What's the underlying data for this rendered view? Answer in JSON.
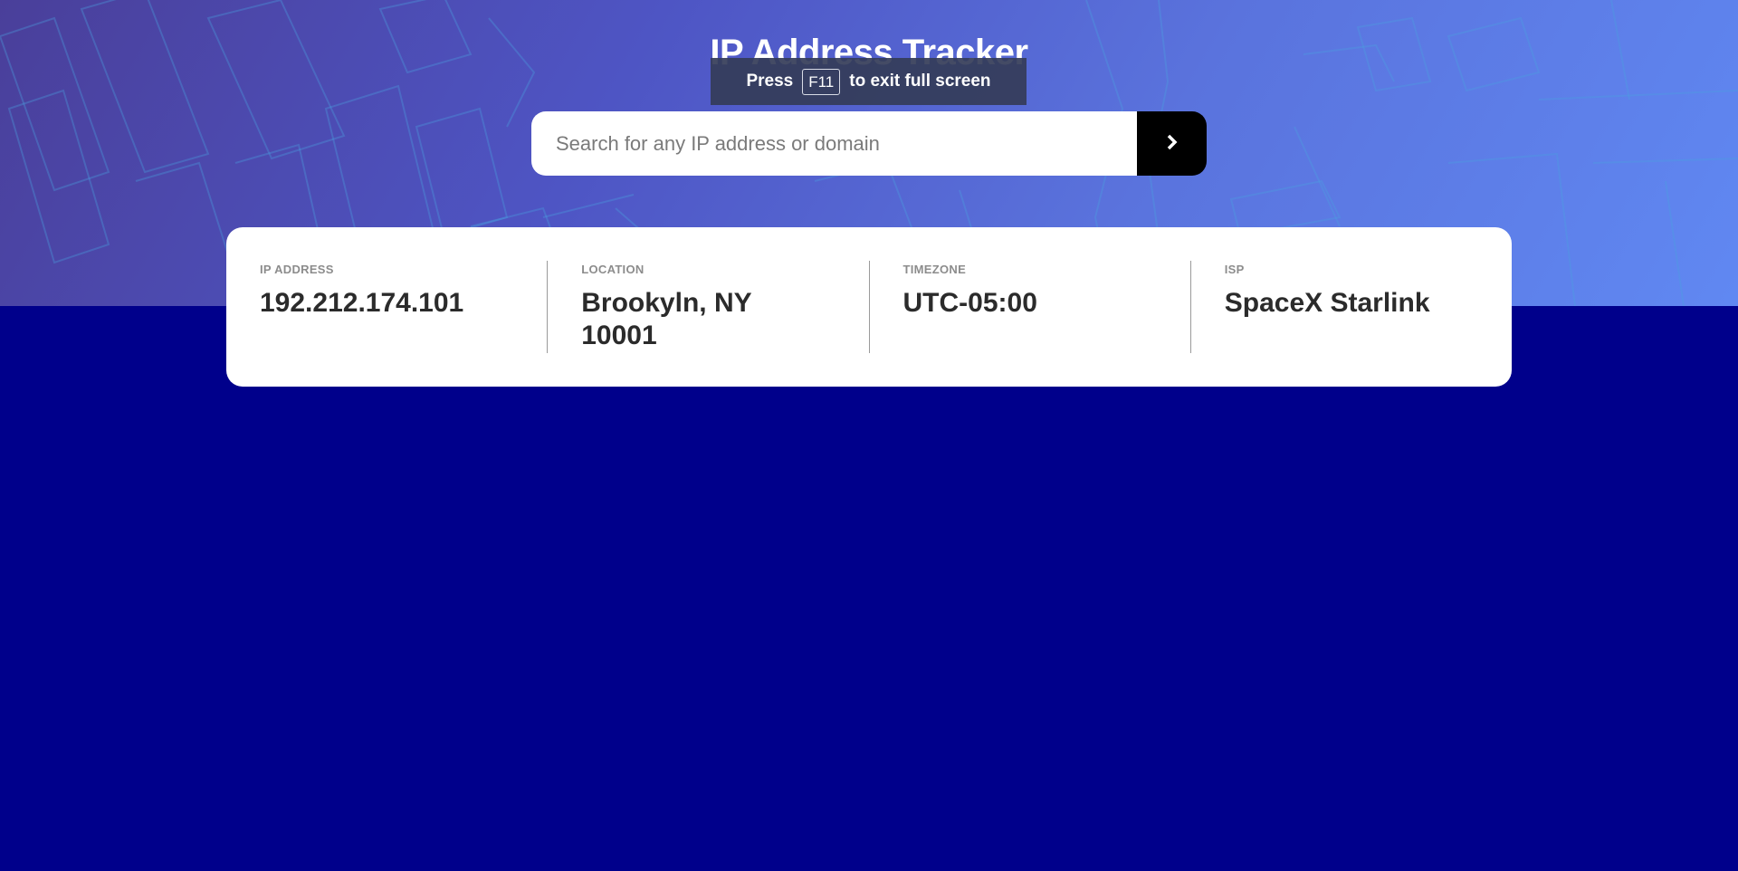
{
  "header": {
    "title": "IP Address Tracker"
  },
  "fullscreen_notice": {
    "prefix": "Press",
    "key": "F11",
    "suffix": "to exit full screen"
  },
  "search": {
    "placeholder": "Search for any IP address or domain",
    "value": "",
    "submit_icon": "chevron-right-icon"
  },
  "info": [
    {
      "label": "IP ADDRESS",
      "value": "192.212.174.101"
    },
    {
      "label": "LOCATION",
      "value": "Brookyln, NY 10001"
    },
    {
      "label": "TIMEZONE",
      "value": "UTC-05:00"
    },
    {
      "label": "ISP",
      "value": "SpaceX Starlink"
    }
  ],
  "colors": {
    "map_area": "#00008b",
    "search_button": "#000000",
    "card": "#ffffff",
    "value_text": "#2b2b2b",
    "label_text": "#8c8c8c"
  }
}
